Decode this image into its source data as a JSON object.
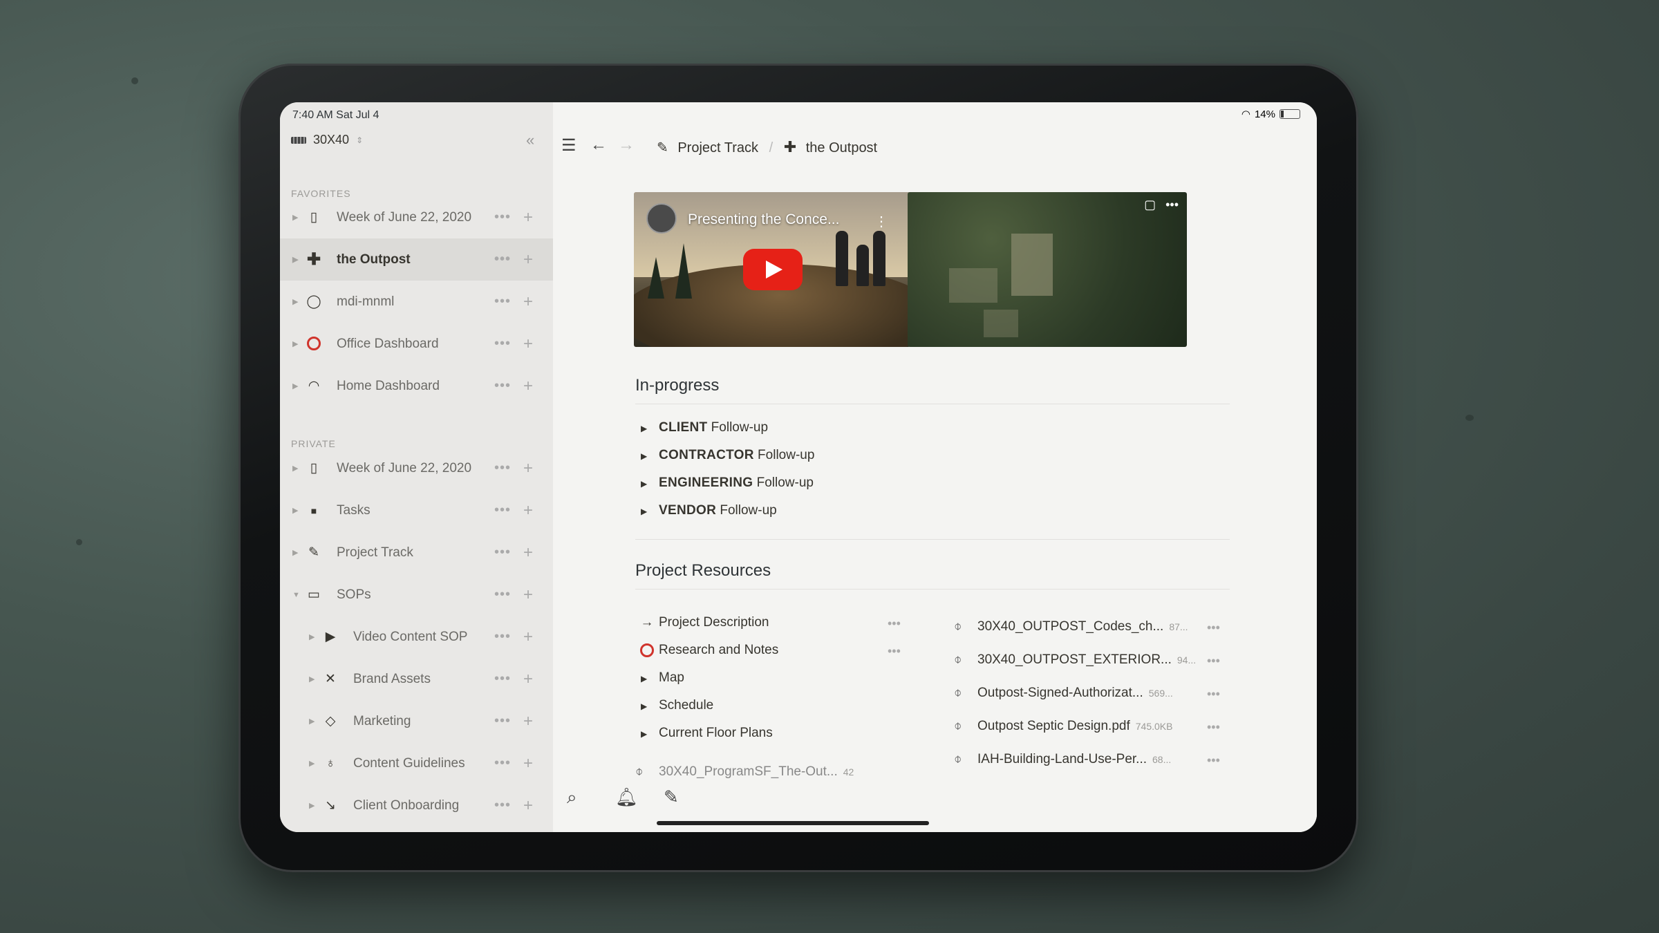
{
  "status": {
    "time": "7:40 AM  Sat Jul 4",
    "battery": "14%"
  },
  "workspace": {
    "name": "30X40",
    "switch_icon": "chevron-updown-icon"
  },
  "sidebar": {
    "favorites_title": "FAVORITES",
    "favorites": [
      {
        "label": "Week of June 22, 2020",
        "icon": "notebook-icon"
      },
      {
        "label": "the Outpost",
        "icon": "plus-cross-icon"
      },
      {
        "label": "mdi-mnml",
        "icon": "drop-icon"
      },
      {
        "label": "Office Dashboard",
        "icon": "red-circle-icon"
      },
      {
        "label": "Home Dashboard",
        "icon": "wifi-icon"
      }
    ],
    "private_title": "PRIVATE",
    "private": [
      {
        "label": "Week of June 22, 2020",
        "icon": "notebook-icon"
      },
      {
        "label": "Tasks",
        "icon": "square-icon"
      },
      {
        "label": "Project Track",
        "icon": "pencil-icon"
      },
      {
        "label": "SOPs",
        "icon": "document-icon"
      },
      {
        "label": "Video Content SOP",
        "icon": "camera-icon"
      },
      {
        "label": "Brand Assets",
        "icon": "x-icon"
      },
      {
        "label": "Marketing",
        "icon": "diamond-icon"
      },
      {
        "label": "Content Guidelines",
        "icon": "bulb-icon"
      },
      {
        "label": "Client Onboarding",
        "icon": "arrow-down-right-icon"
      }
    ]
  },
  "breadcrumb": {
    "parent": "Project Track",
    "sep": "/",
    "current": "the Outpost"
  },
  "video": {
    "title": "Presenting the Conce..."
  },
  "inprogress": {
    "title": "In-progress",
    "items": [
      {
        "bold": "CLIENT",
        "rest": " Follow-up"
      },
      {
        "bold": "CONTRACTOR",
        "rest": " Follow-up"
      },
      {
        "bold": "ENGINEERING",
        "rest": " Follow-up"
      },
      {
        "bold": "VENDOR",
        "rest": " Follow-up"
      }
    ]
  },
  "resources": {
    "title": "Project Resources",
    "pages": [
      "Project Description",
      "Research and Notes",
      "Map",
      "Schedule",
      "Current Floor Plans",
      "30X40_ProgramSF_The-Out..."
    ],
    "partial_size": "42",
    "files": [
      {
        "name": "30X40_OUTPOST_Codes_ch...",
        "size": "87..."
      },
      {
        "name": "30X40_OUTPOST_EXTERIOR...",
        "size": "94..."
      },
      {
        "name": "Outpost-Signed-Authorizat...",
        "size": "569..."
      },
      {
        "name": "Outpost Septic Design.pdf",
        "size": "745.0KB"
      },
      {
        "name": "IAH-Building-Land-Use-Per...",
        "size": "68..."
      }
    ]
  },
  "glyphs": {
    "dots": "•••",
    "plus": "+",
    "tri_right": "▶",
    "tri_down": "▼",
    "collapse": "«",
    "arrow": "→",
    "clip": "⌀"
  }
}
